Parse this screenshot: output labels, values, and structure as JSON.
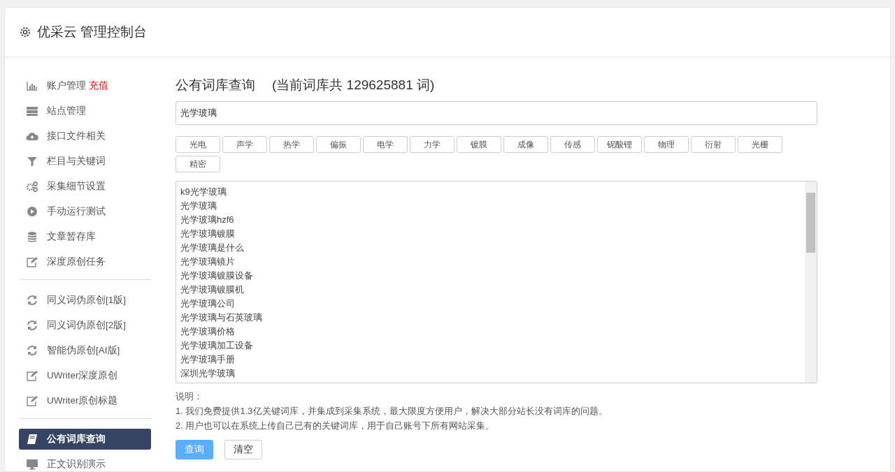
{
  "header": {
    "title": "优采云 管理控制台"
  },
  "sidebar": {
    "groups": [
      [
        {
          "label": "账户管理",
          "kind": "chart",
          "badge": "充值",
          "selected": false
        },
        {
          "label": "站点管理",
          "kind": "server",
          "selected": false
        },
        {
          "label": "接口文件相关",
          "kind": "cloud",
          "selected": false
        },
        {
          "label": "栏目与关键词",
          "kind": "filter",
          "selected": false
        },
        {
          "label": "采集细节设置",
          "kind": "gears",
          "selected": false
        },
        {
          "label": "手动运行测试",
          "kind": "play",
          "selected": false
        },
        {
          "label": "文章暂存库",
          "kind": "database",
          "selected": false
        },
        {
          "label": "深度原创任务",
          "kind": "edit",
          "selected": false
        }
      ],
      [
        {
          "label": "同义词伪原创[1版]",
          "kind": "refresh",
          "selected": false
        },
        {
          "label": "同义词伪原创[2版]",
          "kind": "refresh",
          "selected": false
        },
        {
          "label": "智能伪原创[AI版]",
          "kind": "refresh",
          "selected": false
        },
        {
          "label": "UWriter深度原创",
          "kind": "edit",
          "selected": false
        },
        {
          "label": "UWriter原创标题",
          "kind": "edit",
          "selected": false
        }
      ],
      [
        {
          "label": "公有词库查询",
          "kind": "book",
          "selected": true
        },
        {
          "label": "正文识别演示",
          "kind": "monitor",
          "selected": false
        }
      ]
    ]
  },
  "main": {
    "title": "公有词库查询",
    "count_text": "(当前词库共 129625881 词)",
    "search": {
      "value": "光学玻璃"
    },
    "tags": [
      "光电",
      "声学",
      "热学",
      "偏振",
      "电学",
      "力学",
      "镀膜",
      "成像",
      "传感",
      "铌酸锂",
      "物理",
      "衍射",
      "光栅",
      "精密"
    ],
    "results": [
      "k9光学玻璃",
      "光学玻璃",
      "光学玻璃hzf6",
      "光学玻璃镀膜",
      "光学玻璃是什么",
      "光学玻璃镜片",
      "光学玻璃镀膜设备",
      "光学玻璃镀膜机",
      "光学玻璃公司",
      "光学玻璃与石英玻璃",
      "光学玻璃价格",
      "光学玻璃加工设备",
      "光学玻璃手册",
      "深圳光学玻璃"
    ],
    "notes_title": "说明：",
    "notes": [
      "1. 我们免费提供1.3亿关键词库，并集成到采集系统，最大限度方便用户，解决大部分站长没有词库的问题。",
      "2. 用户也可以在系统上传自己已有的关键词库，用于自己账号下所有网站采集。"
    ],
    "buttons": [
      {
        "label": "查询",
        "kind": "primary"
      },
      {
        "label": "清空",
        "kind": "default"
      }
    ]
  }
}
